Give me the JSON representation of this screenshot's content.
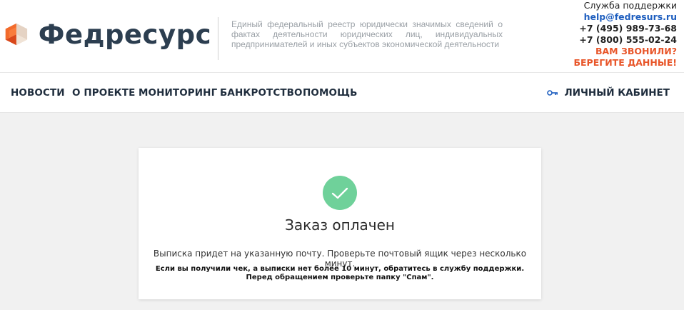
{
  "header": {
    "logo_text": "Федресурс",
    "tagline": "Единый федеральный реестр юридически значимых сведений о фактах деятельности юридических лиц, индивидуальных предпринимателей и иных субъектов экономической деятельности"
  },
  "support": {
    "title": "Служба поддержки",
    "email": "help@fedresurs.ru",
    "phone1": "+7 (495) 989-73-68",
    "phone2": "+7 (800) 555-02-24",
    "alert_line1": "ВАМ ЗВОНИЛИ?",
    "alert_line2": "БЕРЕГИТЕ ДАННЫЕ!"
  },
  "nav": {
    "items": [
      {
        "label": "НОВОСТИ"
      },
      {
        "label": "О ПРОЕКТЕ"
      },
      {
        "label": "МОНИТОРИНГ"
      },
      {
        "label": "БАНКРОТСТВО"
      },
      {
        "label": "ПОМОЩЬ"
      }
    ],
    "cabinet_label": "ЛИЧНЫЙ КАБИНЕТ"
  },
  "card": {
    "title": "Заказ оплачен",
    "message": "Выписка придет на указанную почту. Проверьте почтовый ящик через несколько минут.",
    "note_line1": "Если вы получили чек, а выписки нет более 10 минут, обратитесь в службу поддержки.",
    "note_line2": "Перед обращением проверьте папку \"Спам\"."
  },
  "colors": {
    "brand_dark": "#2c3e50",
    "accent_orange": "#e8562a",
    "link_blue": "#1e5ebf",
    "success_green": "#6fd19a"
  },
  "icons": {
    "logo": "fedresurs-logo-icon",
    "key": "key-icon",
    "check": "checkmark-icon"
  }
}
